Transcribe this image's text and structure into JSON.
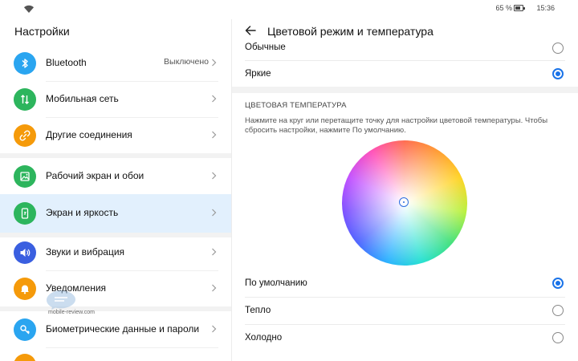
{
  "status_bar": {
    "battery": "65 %",
    "time": "15:36",
    "icons": [
      "wifi-icon",
      "battery-icon"
    ]
  },
  "settings": {
    "title": "Настройки",
    "items": [
      {
        "label": "Bluetooth",
        "value": "Выключено",
        "icon": "bluetooth-icon",
        "color": "#2aa5f0"
      },
      {
        "label": "Мобильная сеть",
        "value": "",
        "icon": "mobile-data-icon",
        "color": "#2db55d"
      },
      {
        "label": "Другие соединения",
        "value": "",
        "icon": "link-icon",
        "color": "#f59a0a"
      },
      {
        "label": "Рабочий экран и обои",
        "value": "",
        "icon": "wallpaper-icon",
        "color": "#2db55d"
      },
      {
        "label": "Экран и яркость",
        "value": "",
        "icon": "display-icon",
        "color": "#2db55d"
      },
      {
        "label": "Звуки и вибрация",
        "value": "",
        "icon": "sound-icon",
        "color": "#3a5fe0"
      },
      {
        "label": "Уведомления",
        "value": "",
        "icon": "bell-icon",
        "color": "#f59a0a"
      },
      {
        "label": "Биометрические данные и пароли",
        "value": "",
        "icon": "key-icon",
        "color": "#2aa5f0"
      }
    ]
  },
  "detail": {
    "title": "Цветовой режим и температура",
    "modes": [
      {
        "label": "Обычные",
        "selected": false
      },
      {
        "label": "Яркие",
        "selected": true
      }
    ],
    "temperature_title": "ЦВЕТОВАЯ ТЕМПЕРАТУРА",
    "temperature_desc": "Нажмите на круг или перетащите точку для настройки цветовой температуры. Чтобы сбросить настройки, нажмите По умолчанию.",
    "temperature_options": [
      {
        "label": "По умолчанию",
        "selected": true
      },
      {
        "label": "Тепло",
        "selected": false
      },
      {
        "label": "Холодно",
        "selected": false
      }
    ],
    "accent_color": "#1a73e8"
  },
  "watermark": "mobile-review.com"
}
